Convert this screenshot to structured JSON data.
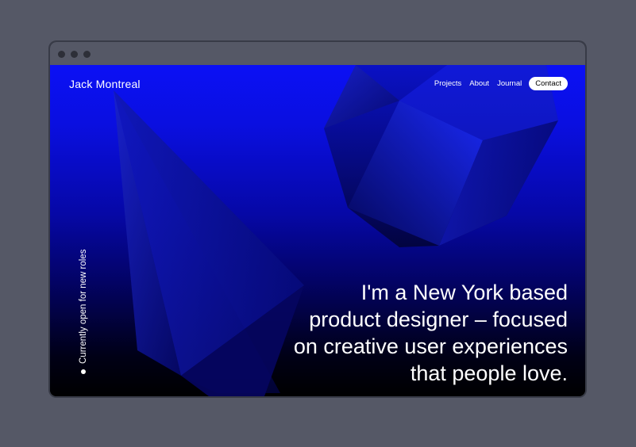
{
  "brand": {
    "name": "Jack Montreal"
  },
  "nav": {
    "items": [
      {
        "label": "Projects"
      },
      {
        "label": "About"
      },
      {
        "label": "Journal"
      }
    ],
    "cta": "Contact"
  },
  "status": {
    "text": "Currently open for new roles"
  },
  "headline": {
    "lines": [
      "I'm a New York based",
      "product designer – focused",
      "on creative user experiences",
      "that people love."
    ]
  },
  "colors": {
    "background": "#555866",
    "hero_top": "#0b10f5",
    "hero_bottom": "#000000",
    "text": "#ffffff"
  }
}
